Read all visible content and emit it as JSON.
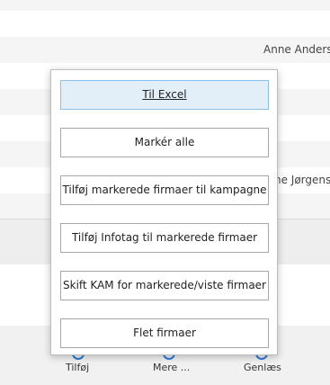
{
  "background_rows": {
    "row_name_1": "Anne Anders",
    "row_name_2": "ne Jørgens"
  },
  "toolbar": {
    "items": [
      {
        "label": "Tilføj"
      },
      {
        "label": "Mere ..."
      },
      {
        "label": "Genlæs"
      }
    ]
  },
  "popup_menu": {
    "buttons": [
      {
        "label": "Til Excel"
      },
      {
        "label": "Markér alle"
      },
      {
        "label": "Tilføj markerede firmaer til kampagne"
      },
      {
        "label": "Tilføj Infotag til markerede firmaer"
      },
      {
        "label": "Skift KAM for markerede/viste firmaer"
      },
      {
        "label": "Flet firmaer"
      }
    ]
  },
  "colors": {
    "primary_button_bg": "#e2eff9",
    "primary_button_border": "#8dbee6",
    "toolbar_icon": "#2e7bd6"
  }
}
